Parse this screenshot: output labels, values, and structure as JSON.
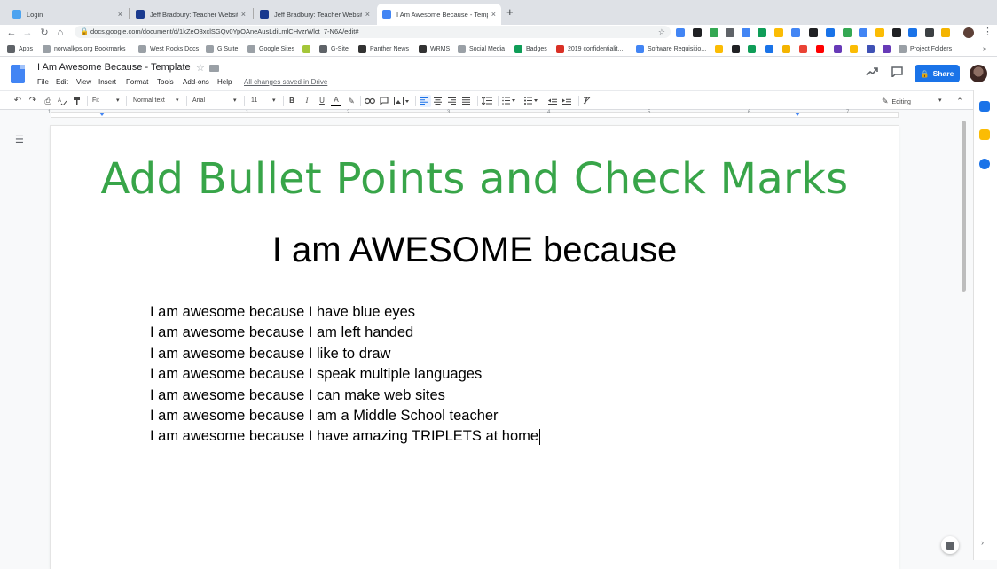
{
  "browser": {
    "tabs": [
      {
        "title": "Login",
        "icon": "cloud-favicon",
        "color": "#4da3f0"
      },
      {
        "title": "Jeff Bradbury: Teacher Website",
        "icon": "site-favicon",
        "color": "#1a3a8f"
      },
      {
        "title": "Jeff Bradbury: Teacher Website",
        "icon": "site-favicon",
        "color": "#1a3a8f"
      },
      {
        "title": "I Am Awesome Because - Templ",
        "icon": "docs-favicon",
        "color": "#4285f4"
      }
    ],
    "new_tab": "+",
    "close": "×",
    "url": "docs.google.com/document/d/1kZeO3xclSGQv0YpOAneAusLdiLmlCHvzrWlct_7-N6A/edit#"
  },
  "bookmarks": [
    {
      "label": "Apps",
      "icon": "apps-grid-icon",
      "color": "#5f6368"
    },
    {
      "label": "norwalkps.org Bookmarks",
      "icon": "folder-icon",
      "color": "#9aa0a6"
    },
    {
      "label": "West Rocks Docs",
      "icon": "folder-icon",
      "color": "#9aa0a6"
    },
    {
      "label": "G Suite",
      "icon": "folder-icon",
      "color": "#9aa0a6"
    },
    {
      "label": "Google Sites",
      "icon": "folder-icon",
      "color": "#9aa0a6"
    },
    {
      "label": "",
      "icon": "android-icon",
      "color": "#a4c639"
    },
    {
      "label": "G-Site",
      "icon": "link-icon",
      "color": "#5f6368"
    },
    {
      "label": "Panther News",
      "icon": "panther-icon",
      "color": "#333333"
    },
    {
      "label": "WRMS",
      "icon": "panther-icon",
      "color": "#333333"
    },
    {
      "label": "Social Media",
      "icon": "folder-icon",
      "color": "#9aa0a6"
    },
    {
      "label": "Badges",
      "icon": "sheets-icon",
      "color": "#0f9d58"
    },
    {
      "label": "2019 confidentialit...",
      "icon": "pdf-icon",
      "color": "#d93025"
    },
    {
      "label": "Software Requisitio...",
      "icon": "docs-icon",
      "color": "#4285f4"
    },
    {
      "label": "",
      "icon": "drive-icon",
      "color": "#fbbc04"
    },
    {
      "label": "",
      "icon": "github-icon",
      "color": "#202124"
    },
    {
      "label": "",
      "icon": "classroom-icon",
      "color": "#0f9d58"
    },
    {
      "label": "",
      "icon": "calendar-icon",
      "color": "#1a73e8"
    },
    {
      "label": "",
      "icon": "slides-icon",
      "color": "#f4b400"
    },
    {
      "label": "",
      "icon": "gmail-icon",
      "color": "#ea4335"
    },
    {
      "label": "",
      "icon": "youtube-icon",
      "color": "#ff0000"
    },
    {
      "label": "",
      "icon": "forms-icon",
      "color": "#673ab7"
    },
    {
      "label": "",
      "icon": "keep-icon",
      "color": "#fbbc04"
    },
    {
      "label": "",
      "icon": "sites-icon",
      "color": "#3f51b5"
    },
    {
      "label": "",
      "icon": "forms-icon",
      "color": "#673ab7"
    },
    {
      "label": "Project Folders",
      "icon": "folder-icon",
      "color": "#9aa0a6"
    },
    {
      "label": "»",
      "icon": "",
      "color": "#5f6368"
    }
  ],
  "doc": {
    "title": "I Am Awesome Because - Template",
    "menu": [
      "File",
      "Edit",
      "View",
      "Insert",
      "Format",
      "Tools",
      "Add-ons",
      "Help"
    ],
    "save_status": "All changes saved in Drive",
    "share_label": "Share"
  },
  "toolbar": {
    "zoom": "Fit",
    "style": "Normal text",
    "font": "Arial",
    "font_size": "11",
    "bold": "B",
    "italic": "I",
    "underline": "U",
    "text_color": "A",
    "mode": "Editing"
  },
  "ruler": {
    "marks": [
      "1",
      "1",
      "2",
      "3",
      "4",
      "5",
      "6",
      "7"
    ]
  },
  "content": {
    "heading1": "Add Bullet Points and Check Marks",
    "heading2": "I am AWESOME because",
    "lines": [
      "I am awesome because I have blue eyes",
      "I am awesome because I am left handed",
      "I am awesome because I like to draw",
      "I am awesome because I speak multiple languages",
      "I am awesome because I can make web sites",
      "I am awesome because I am a Middle School teacher",
      "I am awesome because I have amazing TRIPLETS at home"
    ]
  },
  "colors": {
    "heading1": "#38a549",
    "accent": "#1a73e8"
  }
}
